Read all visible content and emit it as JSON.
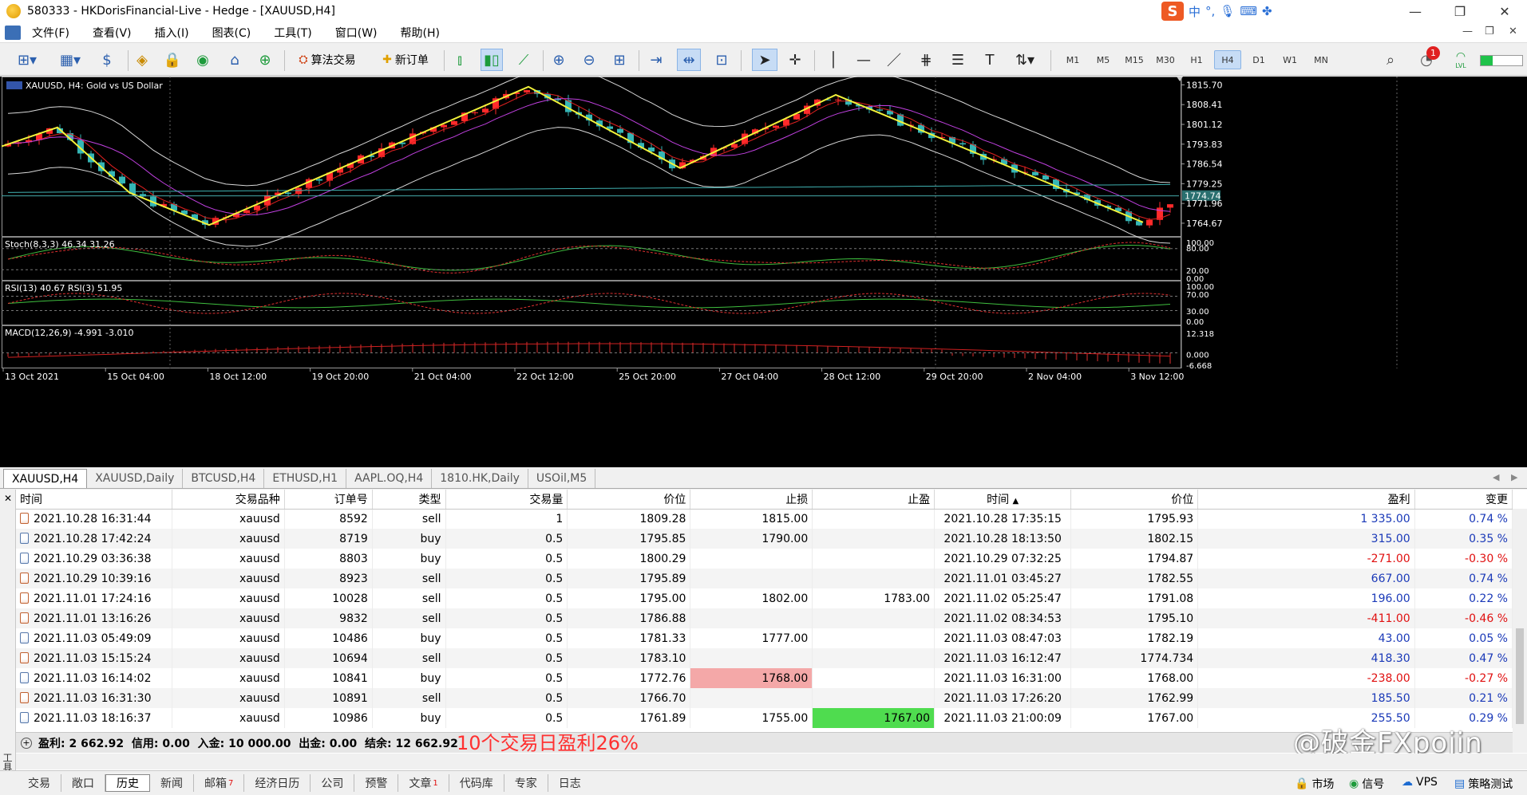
{
  "window": {
    "title": "580333 - HKDorisFinancial-Live - Hedge - [XAUUSD,H4]",
    "ime": {
      "logo": "S",
      "lang": "中"
    }
  },
  "menu": [
    "文件(F)",
    "查看(V)",
    "插入(I)",
    "图表(C)",
    "工具(T)",
    "窗口(W)",
    "帮助(H)"
  ],
  "toolbar": {
    "algo_trading": "算法交易",
    "new_order": "新订单",
    "timeframes": [
      "M1",
      "M5",
      "M15",
      "M30",
      "H1",
      "H4",
      "D1",
      "W1",
      "MN"
    ],
    "active_timeframe": "H4",
    "notification_count": "1",
    "lvl": "LVL"
  },
  "chart": {
    "symbol_label": "XAUUSD, H4:  Gold vs US Dollar",
    "price_ticks": [
      "1815.70",
      "1808.41",
      "1801.12",
      "1793.83",
      "1786.54",
      "1779.25",
      "1771.96",
      "1764.67"
    ],
    "current_price": "1774.74",
    "stoch_label": "Stoch(8,3,3) 46.34 31.26",
    "stoch_ticks": [
      "100.00",
      "80.00",
      "20.00",
      "0.00"
    ],
    "rsi_label": "RSI(13) 40.67 RSI(3) 51.95",
    "rsi_ticks": [
      "100.00",
      "70.00",
      "30.00",
      "0.00"
    ],
    "macd_label": "MACD(12,26,9) -4.991 -3.010",
    "macd_ticks": [
      "12.318",
      "0.000",
      "-6.668"
    ],
    "time_labels": [
      "13 Oct 2021",
      "15 Oct 04:00",
      "18 Oct 12:00",
      "19 Oct 20:00",
      "21 Oct 04:00",
      "22 Oct 12:00",
      "25 Oct 20:00",
      "27 Oct 04:00",
      "28 Oct 12:00",
      "29 Oct 20:00",
      "2 Nov 04:00",
      "3 Nov 12:00"
    ],
    "colors": {
      "bull": "#ff2a2a",
      "bear": "#35b6b6",
      "zigzag": "#f2f23a",
      "ma_fast": "#e02020",
      "ma_slow": "#c040e0",
      "band": "#d8d8d8"
    }
  },
  "chart_tabs": [
    "XAUUSD,H4",
    "XAUUSD,Daily",
    "BTCUSD,H4",
    "ETHUSD,H1",
    "AAPL.OQ,H4",
    "1810.HK,Daily",
    "USOil,M5"
  ],
  "history": {
    "columns": [
      "时间",
      "交易品种",
      "订单号",
      "类型",
      "交易量",
      "价位",
      "止损",
      "止盈",
      "时间",
      "价位",
      "盈利",
      "变更"
    ],
    "sort_column": "时间",
    "rows": [
      {
        "open_time": "2021.10.28 16:31:44",
        "symbol": "xauusd",
        "order": "8592",
        "type": "sell",
        "volume": "1",
        "open_price": "1809.28",
        "sl": "1815.00",
        "tp": "",
        "close_time": "2021.10.28 17:35:15",
        "close_price": "1795.93",
        "profit": "1 335.00",
        "change": "0.74 %"
      },
      {
        "open_time": "2021.10.28 17:42:24",
        "symbol": "xauusd",
        "order": "8719",
        "type": "buy",
        "volume": "0.5",
        "open_price": "1795.85",
        "sl": "1790.00",
        "tp": "",
        "close_time": "2021.10.28 18:13:50",
        "close_price": "1802.15",
        "profit": "315.00",
        "change": "0.35 %"
      },
      {
        "open_time": "2021.10.29 03:36:38",
        "symbol": "xauusd",
        "order": "8803",
        "type": "buy",
        "volume": "0.5",
        "open_price": "1800.29",
        "sl": "",
        "tp": "",
        "close_time": "2021.10.29 07:32:25",
        "close_price": "1794.87",
        "profit": "-271.00",
        "change": "-0.30 %"
      },
      {
        "open_time": "2021.10.29 10:39:16",
        "symbol": "xauusd",
        "order": "8923",
        "type": "sell",
        "volume": "0.5",
        "open_price": "1795.89",
        "sl": "",
        "tp": "",
        "close_time": "2021.11.01 03:45:27",
        "close_price": "1782.55",
        "profit": "667.00",
        "change": "0.74 %"
      },
      {
        "open_time": "2021.11.01 17:24:16",
        "symbol": "xauusd",
        "order": "10028",
        "type": "sell",
        "volume": "0.5",
        "open_price": "1795.00",
        "sl": "1802.00",
        "tp": "1783.00",
        "close_time": "2021.11.02 05:25:47",
        "close_price": "1791.08",
        "profit": "196.00",
        "change": "0.22 %"
      },
      {
        "open_time": "2021.11.01 13:16:26",
        "symbol": "xauusd",
        "order": "9832",
        "type": "sell",
        "volume": "0.5",
        "open_price": "1786.88",
        "sl": "",
        "tp": "",
        "close_time": "2021.11.02 08:34:53",
        "close_price": "1795.10",
        "profit": "-411.00",
        "change": "-0.46 %"
      },
      {
        "open_time": "2021.11.03 05:49:09",
        "symbol": "xauusd",
        "order": "10486",
        "type": "buy",
        "volume": "0.5",
        "open_price": "1781.33",
        "sl": "1777.00",
        "tp": "",
        "close_time": "2021.11.03 08:47:03",
        "close_price": "1782.19",
        "profit": "43.00",
        "change": "0.05 %"
      },
      {
        "open_time": "2021.11.03 15:15:24",
        "symbol": "xauusd",
        "order": "10694",
        "type": "sell",
        "volume": "0.5",
        "open_price": "1783.10",
        "sl": "",
        "tp": "",
        "close_time": "2021.11.03 16:12:47",
        "close_price": "1774.734",
        "profit": "418.30",
        "change": "0.47 %"
      },
      {
        "open_time": "2021.11.03 16:14:02",
        "symbol": "xauusd",
        "order": "10841",
        "type": "buy",
        "volume": "0.5",
        "open_price": "1772.76",
        "sl": "1768.00",
        "tp": "",
        "close_time": "2021.11.03 16:31:00",
        "close_price": "1768.00",
        "profit": "-238.00",
        "change": "-0.27 %",
        "sl_hit": true
      },
      {
        "open_time": "2021.11.03 16:31:30",
        "symbol": "xauusd",
        "order": "10891",
        "type": "sell",
        "volume": "0.5",
        "open_price": "1766.70",
        "sl": "",
        "tp": "",
        "close_time": "2021.11.03 17:26:20",
        "close_price": "1762.99",
        "profit": "185.50",
        "change": "0.21 %"
      },
      {
        "open_time": "2021.11.03 18:16:37",
        "symbol": "xauusd",
        "order": "10986",
        "type": "buy",
        "volume": "0.5",
        "open_price": "1761.89",
        "sl": "1755.00",
        "tp": "1767.00",
        "close_time": "2021.11.03 21:00:09",
        "close_price": "1767.00",
        "profit": "255.50",
        "change": "0.29 %",
        "tp_hit": true
      }
    ],
    "summary": "盈利: 2 662.92  信用: 0.00  入金: 10 000.00  出金: 0.00  结余: 12 662.92",
    "annotation": "10个交易日盈利26%",
    "watermark": "@破金FXpojin",
    "side_label": "工具箱"
  },
  "bottom_tabs": [
    {
      "label": "交易",
      "badge": ""
    },
    {
      "label": "敞口",
      "badge": ""
    },
    {
      "label": "历史",
      "badge": ""
    },
    {
      "label": "新闻",
      "badge": ""
    },
    {
      "label": "邮箱",
      "badge": "7"
    },
    {
      "label": "经济日历",
      "badge": ""
    },
    {
      "label": "公司",
      "badge": ""
    },
    {
      "label": "预警",
      "badge": ""
    },
    {
      "label": "文章",
      "badge": "1"
    },
    {
      "label": "代码库",
      "badge": ""
    },
    {
      "label": "专家",
      "badge": ""
    },
    {
      "label": "日志",
      "badge": ""
    }
  ],
  "active_bottom_tab": "历史",
  "status_right": [
    "市场",
    "信号",
    "VPS",
    "策略测试"
  ]
}
